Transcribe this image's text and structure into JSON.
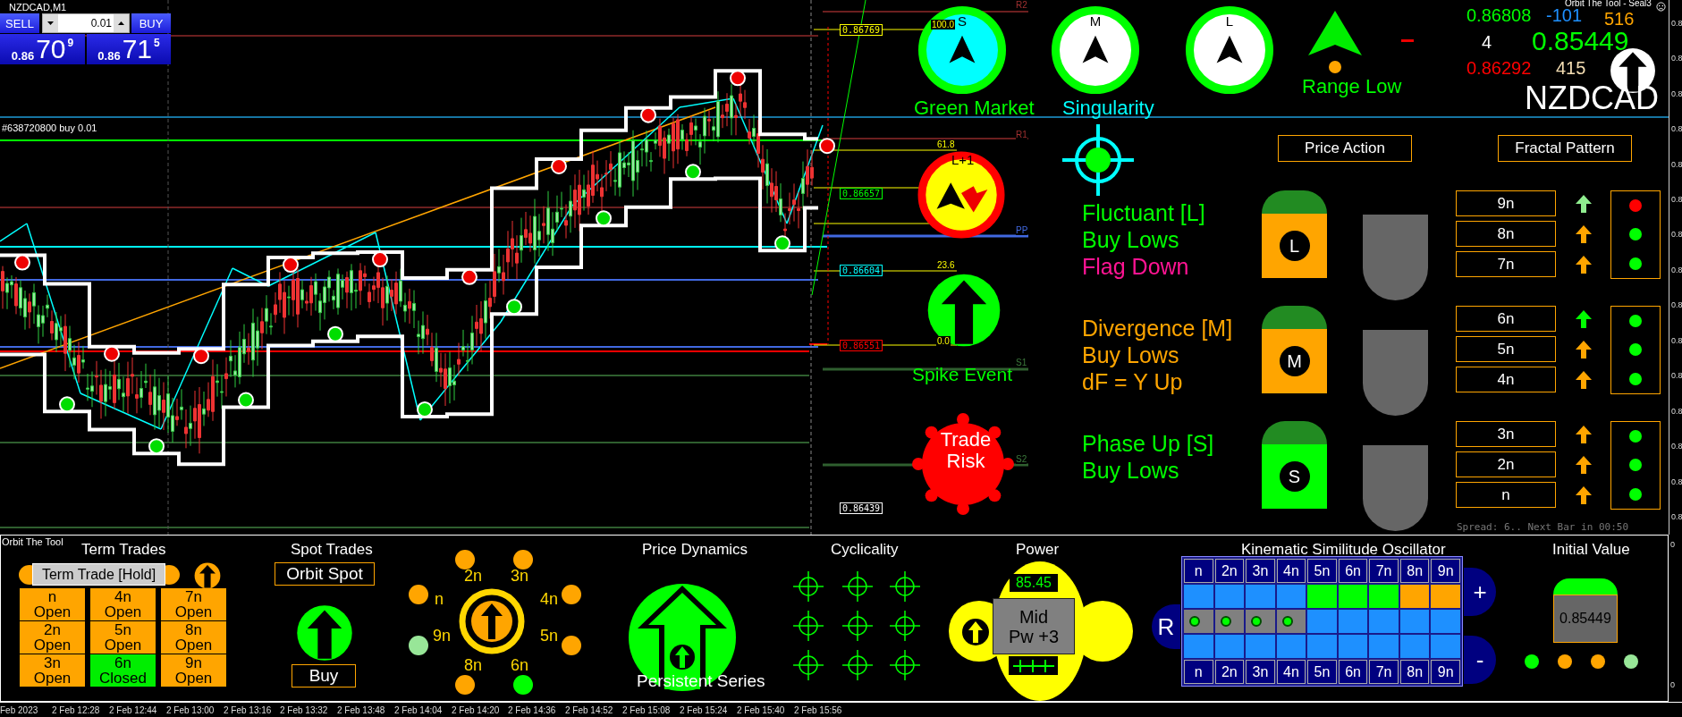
{
  "chart": {
    "symbol": "NZDCAD,M1",
    "order_line": "#638720800 buy 0.01",
    "price_tags": [
      {
        "text": "0.86769",
        "color": "#ffff00"
      },
      {
        "text": "0.86657",
        "color": "#00ff00"
      },
      {
        "text": "0.86604",
        "color": "#00ffff"
      },
      {
        "text": "0.86551",
        "color": "#ff0000"
      },
      {
        "text": "0.86439",
        "color": "#ffffff"
      }
    ],
    "fib_levels": [
      "100.0",
      "61.8",
      "23.6",
      "0.0"
    ],
    "pivots": [
      "R2",
      "R1",
      "PP",
      "S1",
      "S2"
    ],
    "spread": "Spread: 6.. Next Bar in 00:50"
  },
  "trade_panel": {
    "sell": "SELL",
    "buy": "BUY",
    "lot": "0.01",
    "bid": {
      "head": "0.86",
      "big": "70",
      "tail": "9"
    },
    "ask": {
      "head": "0.86",
      "big": "71",
      "tail": "5"
    }
  },
  "signals": [
    {
      "letter": "S",
      "color": "#00ffff",
      "caption": {
        "text": "Green Market",
        "color": "#00ff00"
      }
    },
    {
      "letter": "M",
      "color": "#ffffff",
      "caption": {
        "text": "Singularity",
        "color": "#00ffff"
      }
    },
    {
      "letter": "L",
      "color": "#ffffff"
    }
  ],
  "range_signal": {
    "label": "Range Low"
  },
  "quotes": {
    "tool": "Orbit The Tool - Seal3",
    "high": "0.86808",
    "delta": "-101",
    "ticks": "516",
    "digits": "4",
    "current": "0.85449",
    "low": "0.86292",
    "bars": "415",
    "symbol": "NZDCAD"
  },
  "markers": {
    "l_plus": "L+1",
    "spike": "Spike Event",
    "risk": "Trade Risk"
  },
  "headers": [
    "Price Action",
    "Fractal Pattern"
  ],
  "groups": [
    {
      "badge": "L",
      "color": "#ffa500",
      "lines": [
        {
          "text": "Fluctuant [L]",
          "color": "#00ff00"
        },
        {
          "text": "Buy Lows",
          "color": "#00ff00"
        },
        {
          "text": "Flag Down",
          "color": "#ff1493"
        }
      ],
      "fractals": [
        {
          "label": "9n",
          "arrow": {
            "color": "#90ee90"
          },
          "color": "#ff0000"
        },
        {
          "label": "8n",
          "arrow": {
            "color": "#ffa500"
          },
          "color": "#00ff00"
        },
        {
          "label": "7n",
          "arrow": {
            "color": "#ffa500"
          },
          "color": "#00ff00"
        }
      ]
    },
    {
      "badge": "M",
      "color": "#ffa500",
      "lines": [
        {
          "text": "Divergence [M]",
          "color": "#ffa500"
        },
        {
          "text": "Buy Lows",
          "color": "#ffa500"
        },
        {
          "text": "dF = Y Up",
          "color": "#ffa500"
        }
      ],
      "fractals": [
        {
          "label": "6n",
          "arrow": {
            "color": "#00ff00"
          },
          "color": "#00ff00"
        },
        {
          "label": "5n",
          "arrow": {
            "color": "#ffa500"
          },
          "color": "#00ff00"
        },
        {
          "label": "4n",
          "arrow": {
            "color": "#ffa500"
          },
          "color": "#00ff00"
        }
      ]
    },
    {
      "badge": "S",
      "color": "#00ff00",
      "lines": [
        {
          "text": "Phase Up [S]",
          "color": "#00ff00"
        },
        {
          "text": "Buy Lows",
          "color": "#00ff00"
        }
      ],
      "fractals": [
        {
          "label": "3n",
          "arrow": {
            "color": "#ffa500"
          },
          "color": "#00ff00"
        },
        {
          "label": "2n",
          "arrow": {
            "color": "#ffa500"
          },
          "color": "#00ff00"
        },
        {
          "label": "n",
          "arrow": {
            "color": "#ffa500"
          },
          "color": "#00ff00"
        }
      ]
    }
  ],
  "bottom": {
    "tool": "Orbit The Tool",
    "term": {
      "title": "Term Trades",
      "hold": "Term Trade [Hold]",
      "slots": [
        {
          "label": "n",
          "status": "Open",
          "closed": false
        },
        {
          "label": "4n",
          "status": "Open",
          "closed": false
        },
        {
          "label": "7n",
          "status": "Open",
          "closed": false
        },
        {
          "label": "2n",
          "status": "Open",
          "closed": false
        },
        {
          "label": "5n",
          "status": "Open",
          "closed": false
        },
        {
          "label": "8n",
          "status": "Open",
          "closed": false
        },
        {
          "label": "3n",
          "status": "Open",
          "closed": false
        },
        {
          "label": "6n",
          "status": "Closed",
          "closed": true
        },
        {
          "label": "9n",
          "status": "Open",
          "closed": false
        }
      ]
    },
    "spot": {
      "title": "Spot Trades",
      "orbit": "Orbit Spot",
      "action": "Buy"
    },
    "orbit_nodes": [
      {
        "label": "2n",
        "color": "#ffa500"
      },
      {
        "label": "3n",
        "color": "#ffa500"
      },
      {
        "label": "n",
        "color": "#ffa500"
      },
      {
        "label": "4n",
        "color": "#ffa500"
      },
      {
        "label": "9n",
        "color": "#98e698"
      },
      {
        "label": "5n",
        "color": "#ffa500"
      },
      {
        "label": "8n",
        "color": "#ffa500"
      },
      {
        "label": "6n",
        "color": "#00ff00"
      }
    ],
    "dynamics": {
      "title": "Price Dynamics",
      "caption": "Persistent Series"
    },
    "cyclicality": {
      "title": "Cyclicality"
    },
    "power": {
      "title": "Power",
      "value": "85.45",
      "lines": [
        "Mid",
        "Pw +3"
      ]
    },
    "kso": {
      "title": "Kinematic Similitude Oscillator",
      "reset": "R",
      "plus": "+",
      "minus": "-",
      "header": [
        "n",
        "2n",
        "3n",
        "4n",
        "5n",
        "6n",
        "7n",
        "8n",
        "9n"
      ],
      "rows": [
        [
          {
            "color": "#1e90ff",
            "dot": false
          },
          {
            "color": "#1e90ff",
            "dot": false
          },
          {
            "color": "#1e90ff",
            "dot": false
          },
          {
            "color": "#1e90ff",
            "dot": false
          },
          {
            "color": "#00ff00",
            "dot": false
          },
          {
            "color": "#00ff00",
            "dot": false
          },
          {
            "color": "#00ff00",
            "dot": false
          },
          {
            "color": "#ffa500",
            "dot": false
          },
          {
            "color": "#ffa500",
            "dot": false
          }
        ],
        [
          {
            "color": "#808080",
            "dot": true
          },
          {
            "color": "#808080",
            "dot": true
          },
          {
            "color": "#808080",
            "dot": true
          },
          {
            "color": "#808080",
            "dot": true
          },
          {
            "color": "#1e90ff",
            "dot": false
          },
          {
            "color": "#1e90ff",
            "dot": false
          },
          {
            "color": "#1e90ff",
            "dot": false
          },
          {
            "color": "#1e90ff",
            "dot": false
          },
          {
            "color": "#1e90ff",
            "dot": false
          }
        ],
        [
          {
            "color": "#1e90ff",
            "dot": false
          },
          {
            "color": "#1e90ff",
            "dot": false
          },
          {
            "color": "#1e90ff",
            "dot": false
          },
          {
            "color": "#1e90ff",
            "dot": false
          },
          {
            "color": "#1e90ff",
            "dot": false
          },
          {
            "color": "#1e90ff",
            "dot": false
          },
          {
            "color": "#1e90ff",
            "dot": false
          },
          {
            "color": "#1e90ff",
            "dot": false
          },
          {
            "color": "#1e90ff",
            "dot": false
          }
        ]
      ],
      "footer": [
        "n",
        "2n",
        "3n",
        "4n",
        "5n",
        "6n",
        "7n",
        "8n",
        "9n"
      ]
    },
    "initial": {
      "title": "Initial Value",
      "value": "0.85449",
      "dots": [
        {
          "color": "#00ff00"
        },
        {
          "color": "#ffa500"
        },
        {
          "color": "#ffa500"
        },
        {
          "color": "#98e698"
        }
      ]
    }
  },
  "price_axis": [
    "0.8",
    "0.8",
    "0.8",
    "0.8",
    "0.8",
    "0.8",
    "0.8",
    "0.8",
    "0.8",
    "0.8",
    "0.8",
    "0.8",
    "0.8",
    "0.8",
    "0.8"
  ],
  "sub_axis": [
    "0",
    "0"
  ],
  "time_axis": [
    "Feb 2023",
    "2 Feb 12:28",
    "2 Feb 12:44",
    "2 Feb 13:00",
    "2 Feb 13:16",
    "2 Feb 13:32",
    "2 Feb 13:48",
    "2 Feb 14:04",
    "2 Feb 14:20",
    "2 Feb 14:36",
    "2 Feb 14:52",
    "2 Feb 15:08",
    "2 Feb 15:24",
    "2 Feb 15:40",
    "2 Feb 15:56"
  ]
}
